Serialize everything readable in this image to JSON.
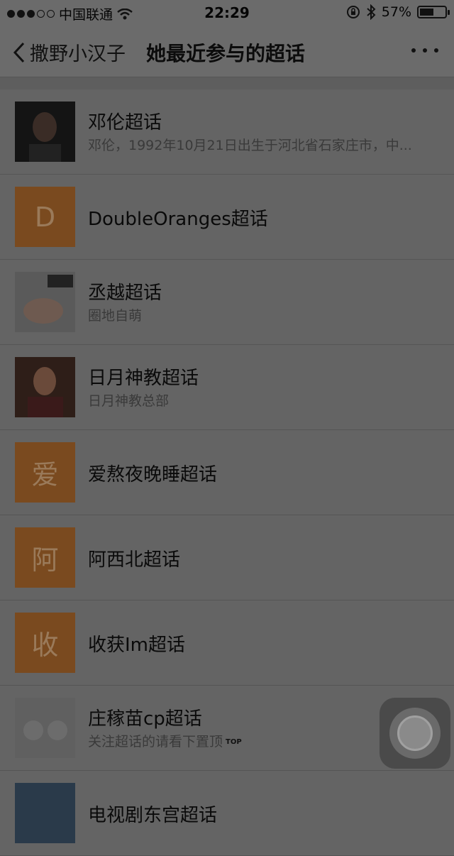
{
  "status": {
    "carrier": "中国联通",
    "time": "22:29",
    "battery_percent_text": "57%",
    "battery_level": 0.57
  },
  "nav": {
    "back_label": "撒野小汉子",
    "title": "她最近参与的超话"
  },
  "list": [
    {
      "avatar_letter": "",
      "title": "邓伦超话",
      "subtitle": "邓伦，1992年10月21日出生于河北省石家庄市，中..."
    },
    {
      "avatar_letter": "D",
      "title": "DoubleOranges超话",
      "subtitle": ""
    },
    {
      "avatar_letter": "",
      "title": "丞越超话",
      "subtitle": "圈地自萌"
    },
    {
      "avatar_letter": "",
      "title": "日月神教超话",
      "subtitle": "日月神教总部"
    },
    {
      "avatar_letter": "爱",
      "title": "爱熬夜晚睡超话",
      "subtitle": ""
    },
    {
      "avatar_letter": "阿",
      "title": "阿西北超话",
      "subtitle": ""
    },
    {
      "avatar_letter": "收",
      "title": "收获Im超话",
      "subtitle": ""
    },
    {
      "avatar_letter": "",
      "title": "庄稼苗cp超话",
      "subtitle": "关注超话的请看下置顶",
      "badge": "TOP"
    },
    {
      "avatar_letter": "",
      "title": "电视剧东宫超话",
      "subtitle": ""
    }
  ]
}
